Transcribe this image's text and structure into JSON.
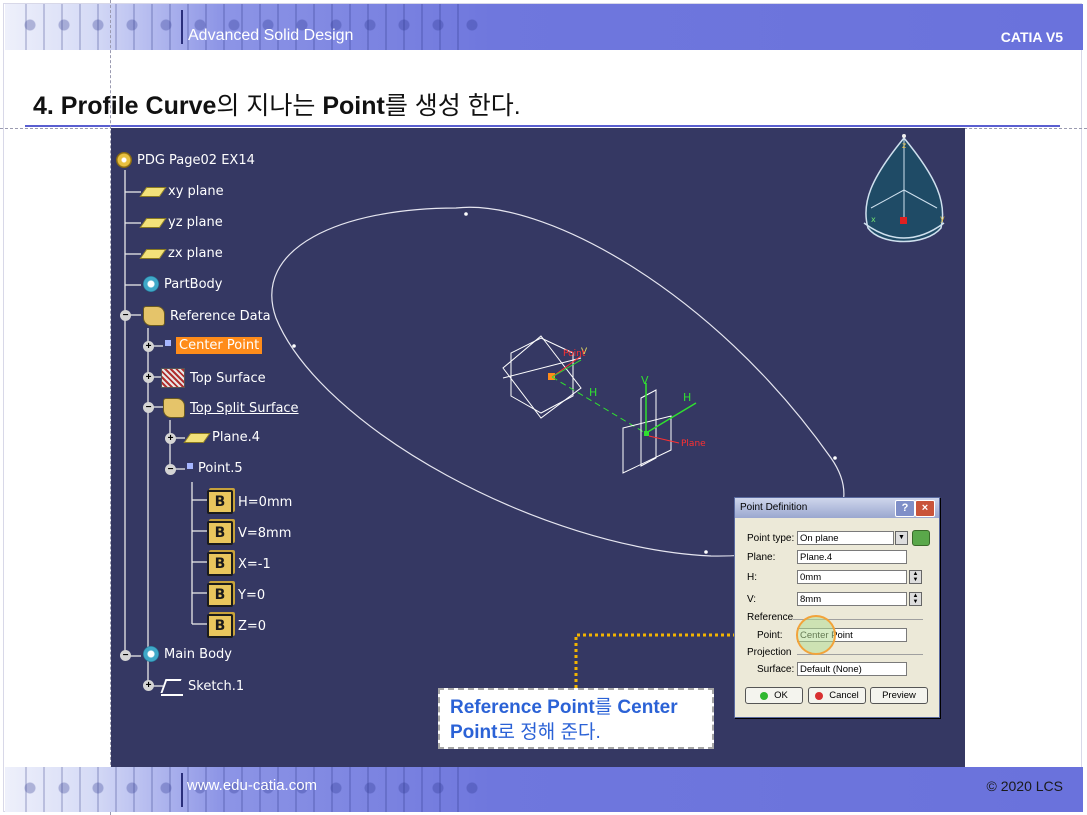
{
  "header": {
    "course_title": "Advanced Solid Design",
    "product": "CATIA V5"
  },
  "slide": {
    "title_parts": [
      "4. Profile Curve",
      "의 지나는 ",
      "Point",
      "를 생성 한다."
    ]
  },
  "tree": {
    "root": "PDG Page02 EX14",
    "items": {
      "xy_plane": "xy plane",
      "yz_plane": "yz plane",
      "zx_plane": "zx plane",
      "partbody": "PartBody",
      "reference_data": "Reference Data",
      "center_point": "Center Point",
      "top_surface": "Top Surface",
      "top_split_surface": "Top Split Surface",
      "plane4": "Plane.4",
      "point5": "Point.5",
      "h_param": "H=0mm",
      "v_param": "V=8mm",
      "x_param": "X=-1",
      "y_param": "Y=0",
      "z_param": "Z=0",
      "main_body": "Main Body",
      "sketch1": "Sketch.1"
    },
    "param_icon_letter": "B",
    "highlight_color": "#ff8c1a"
  },
  "viewport": {
    "axis_h": "H",
    "axis_v": "V",
    "label_plane": "Plane",
    "label_point": "Point",
    "compass_z": "z",
    "compass_x": "x",
    "compass_y": "y"
  },
  "dialog": {
    "title": "Point Definition",
    "help_button": "?",
    "close_button": "×",
    "point_type_label": "Point type:",
    "point_type_value": "On plane",
    "plane_label": "Plane:",
    "plane_value": "Plane.4",
    "h_label": "H:",
    "h_value": "0mm",
    "v_label": "V:",
    "v_value": "8mm",
    "reference_group": "Reference",
    "ref_point_label": "Point:",
    "ref_point_value": "Center Point",
    "projection_group": "Projection",
    "surface_label": "Surface:",
    "surface_value": "Default (None)",
    "ok_button": "OK",
    "cancel_button": "Cancel",
    "preview_button": "Preview"
  },
  "callout": {
    "line1_bold": "Reference Point",
    "line1_kr": "를 ",
    "line1_end": "Center",
    "line2_bold": "Point",
    "line2_kr": "로 정해 준다."
  },
  "footer": {
    "website": "www.edu-catia.com",
    "copyright": "© 2020 LCS"
  },
  "colors": {
    "band": "#6f77dd",
    "viewport_bg": "#353863",
    "callout_text": "#2b62d6",
    "dotted_arrow": "#f2b400"
  }
}
